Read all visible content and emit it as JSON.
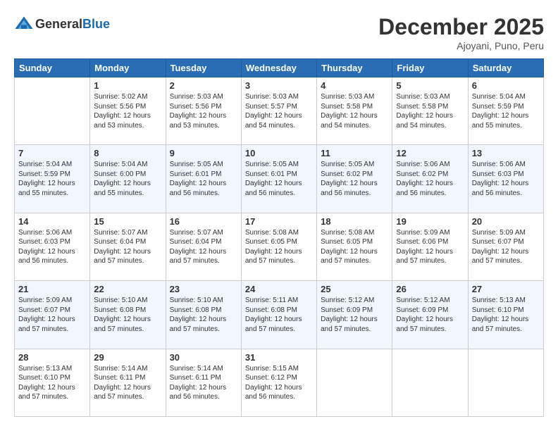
{
  "logo": {
    "text_general": "General",
    "text_blue": "Blue"
  },
  "header": {
    "month": "December 2025",
    "location": "Ajoyani, Puno, Peru"
  },
  "days_of_week": [
    "Sunday",
    "Monday",
    "Tuesday",
    "Wednesday",
    "Thursday",
    "Friday",
    "Saturday"
  ],
  "weeks": [
    [
      {
        "day": "",
        "sunrise": "",
        "sunset": "",
        "daylight": "",
        "empty": true
      },
      {
        "day": "1",
        "sunrise": "Sunrise: 5:02 AM",
        "sunset": "Sunset: 5:56 PM",
        "daylight": "Daylight: 12 hours and 53 minutes."
      },
      {
        "day": "2",
        "sunrise": "Sunrise: 5:03 AM",
        "sunset": "Sunset: 5:56 PM",
        "daylight": "Daylight: 12 hours and 53 minutes."
      },
      {
        "day": "3",
        "sunrise": "Sunrise: 5:03 AM",
        "sunset": "Sunset: 5:57 PM",
        "daylight": "Daylight: 12 hours and 54 minutes."
      },
      {
        "day": "4",
        "sunrise": "Sunrise: 5:03 AM",
        "sunset": "Sunset: 5:58 PM",
        "daylight": "Daylight: 12 hours and 54 minutes."
      },
      {
        "day": "5",
        "sunrise": "Sunrise: 5:03 AM",
        "sunset": "Sunset: 5:58 PM",
        "daylight": "Daylight: 12 hours and 54 minutes."
      },
      {
        "day": "6",
        "sunrise": "Sunrise: 5:04 AM",
        "sunset": "Sunset: 5:59 PM",
        "daylight": "Daylight: 12 hours and 55 minutes."
      }
    ],
    [
      {
        "day": "7",
        "sunrise": "Sunrise: 5:04 AM",
        "sunset": "Sunset: 5:59 PM",
        "daylight": "Daylight: 12 hours and 55 minutes."
      },
      {
        "day": "8",
        "sunrise": "Sunrise: 5:04 AM",
        "sunset": "Sunset: 6:00 PM",
        "daylight": "Daylight: 12 hours and 55 minutes."
      },
      {
        "day": "9",
        "sunrise": "Sunrise: 5:05 AM",
        "sunset": "Sunset: 6:01 PM",
        "daylight": "Daylight: 12 hours and 56 minutes."
      },
      {
        "day": "10",
        "sunrise": "Sunrise: 5:05 AM",
        "sunset": "Sunset: 6:01 PM",
        "daylight": "Daylight: 12 hours and 56 minutes."
      },
      {
        "day": "11",
        "sunrise": "Sunrise: 5:05 AM",
        "sunset": "Sunset: 6:02 PM",
        "daylight": "Daylight: 12 hours and 56 minutes."
      },
      {
        "day": "12",
        "sunrise": "Sunrise: 5:06 AM",
        "sunset": "Sunset: 6:02 PM",
        "daylight": "Daylight: 12 hours and 56 minutes."
      },
      {
        "day": "13",
        "sunrise": "Sunrise: 5:06 AM",
        "sunset": "Sunset: 6:03 PM",
        "daylight": "Daylight: 12 hours and 56 minutes."
      }
    ],
    [
      {
        "day": "14",
        "sunrise": "Sunrise: 5:06 AM",
        "sunset": "Sunset: 6:03 PM",
        "daylight": "Daylight: 12 hours and 56 minutes."
      },
      {
        "day": "15",
        "sunrise": "Sunrise: 5:07 AM",
        "sunset": "Sunset: 6:04 PM",
        "daylight": "Daylight: 12 hours and 57 minutes."
      },
      {
        "day": "16",
        "sunrise": "Sunrise: 5:07 AM",
        "sunset": "Sunset: 6:04 PM",
        "daylight": "Daylight: 12 hours and 57 minutes."
      },
      {
        "day": "17",
        "sunrise": "Sunrise: 5:08 AM",
        "sunset": "Sunset: 6:05 PM",
        "daylight": "Daylight: 12 hours and 57 minutes."
      },
      {
        "day": "18",
        "sunrise": "Sunrise: 5:08 AM",
        "sunset": "Sunset: 6:05 PM",
        "daylight": "Daylight: 12 hours and 57 minutes."
      },
      {
        "day": "19",
        "sunrise": "Sunrise: 5:09 AM",
        "sunset": "Sunset: 6:06 PM",
        "daylight": "Daylight: 12 hours and 57 minutes."
      },
      {
        "day": "20",
        "sunrise": "Sunrise: 5:09 AM",
        "sunset": "Sunset: 6:07 PM",
        "daylight": "Daylight: 12 hours and 57 minutes."
      }
    ],
    [
      {
        "day": "21",
        "sunrise": "Sunrise: 5:09 AM",
        "sunset": "Sunset: 6:07 PM",
        "daylight": "Daylight: 12 hours and 57 minutes."
      },
      {
        "day": "22",
        "sunrise": "Sunrise: 5:10 AM",
        "sunset": "Sunset: 6:08 PM",
        "daylight": "Daylight: 12 hours and 57 minutes."
      },
      {
        "day": "23",
        "sunrise": "Sunrise: 5:10 AM",
        "sunset": "Sunset: 6:08 PM",
        "daylight": "Daylight: 12 hours and 57 minutes."
      },
      {
        "day": "24",
        "sunrise": "Sunrise: 5:11 AM",
        "sunset": "Sunset: 6:08 PM",
        "daylight": "Daylight: 12 hours and 57 minutes."
      },
      {
        "day": "25",
        "sunrise": "Sunrise: 5:12 AM",
        "sunset": "Sunset: 6:09 PM",
        "daylight": "Daylight: 12 hours and 57 minutes."
      },
      {
        "day": "26",
        "sunrise": "Sunrise: 5:12 AM",
        "sunset": "Sunset: 6:09 PM",
        "daylight": "Daylight: 12 hours and 57 minutes."
      },
      {
        "day": "27",
        "sunrise": "Sunrise: 5:13 AM",
        "sunset": "Sunset: 6:10 PM",
        "daylight": "Daylight: 12 hours and 57 minutes."
      }
    ],
    [
      {
        "day": "28",
        "sunrise": "Sunrise: 5:13 AM",
        "sunset": "Sunset: 6:10 PM",
        "daylight": "Daylight: 12 hours and 57 minutes."
      },
      {
        "day": "29",
        "sunrise": "Sunrise: 5:14 AM",
        "sunset": "Sunset: 6:11 PM",
        "daylight": "Daylight: 12 hours and 57 minutes."
      },
      {
        "day": "30",
        "sunrise": "Sunrise: 5:14 AM",
        "sunset": "Sunset: 6:11 PM",
        "daylight": "Daylight: 12 hours and 56 minutes."
      },
      {
        "day": "31",
        "sunrise": "Sunrise: 5:15 AM",
        "sunset": "Sunset: 6:12 PM",
        "daylight": "Daylight: 12 hours and 56 minutes."
      },
      {
        "day": "",
        "sunrise": "",
        "sunset": "",
        "daylight": "",
        "empty": true
      },
      {
        "day": "",
        "sunrise": "",
        "sunset": "",
        "daylight": "",
        "empty": true
      },
      {
        "day": "",
        "sunrise": "",
        "sunset": "",
        "daylight": "",
        "empty": true
      }
    ]
  ]
}
